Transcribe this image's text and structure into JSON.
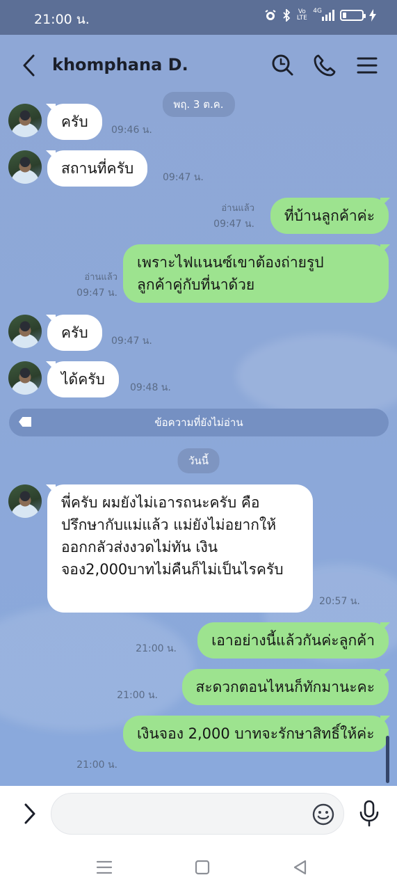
{
  "status_bar": {
    "time": "21:00 น.",
    "battery_level": 0.2,
    "network_label": "4G",
    "volte_label": "Vo LTE"
  },
  "header": {
    "contact_name": "khomphana D.",
    "icons": [
      "back-chevron-icon",
      "search-icon",
      "phone-icon",
      "menu-icon"
    ]
  },
  "chat": {
    "date_separator": "พฤ. 3 ต.ค.",
    "today_separator": "วันนี้",
    "unread_divider": "ข้อความที่ยังไม่อ่าน",
    "messages": [
      {
        "direction": "in",
        "text": "ครับ",
        "time": "09:46 น."
      },
      {
        "direction": "in",
        "text": "สถานที่ครับ",
        "time": "09:47 น."
      },
      {
        "direction": "out",
        "text": "ที่บ้านลูกค้าค่ะ",
        "read": "อ่านแล้ว",
        "time": "09:47 น."
      },
      {
        "direction": "out",
        "text": "เพราะไฟแนนซ์เขาต้องถ่ายรูป ลูกค้าคู่กับที่นาด้วย",
        "read": "อ่านแล้ว",
        "time": "09:47 น."
      },
      {
        "direction": "in",
        "text": "ครับ",
        "time": "09:47 น."
      },
      {
        "direction": "in",
        "text": "ได้ครับ",
        "time": "09:48 น."
      },
      {
        "direction": "in",
        "text": "พี่ครับ  ผมยังไม่เอารถนะครับ  คือปรึกษากับแม่แล้ว แม่ยังไม่อยากให้ออกกลัวส่งงวดไม่ทัน   เงินจอง2,000บาทไม่คืนก็ไม่เป็นไรครับ",
        "time": "20:57 น."
      },
      {
        "direction": "out",
        "text": "เอาอย่างนี้แล้วกันค่ะลูกค้า",
        "time": "21:00 น."
      },
      {
        "direction": "out",
        "text": "สะดวกตอนไหนก็ทักมานะคะ",
        "time": "21:00 น."
      },
      {
        "direction": "out",
        "text": "เงินจอง 2,000 บาทจะรักษาสิทธิ์ให้ค่ะ",
        "time": "21:00 น."
      }
    ]
  },
  "input": {
    "placeholder": "",
    "value": ""
  },
  "colors": {
    "chat_background": "#8da8d8",
    "outgoing_bubble": "#9de38f",
    "incoming_bubble": "#ffffff",
    "status_bar": "#5c6f96"
  }
}
